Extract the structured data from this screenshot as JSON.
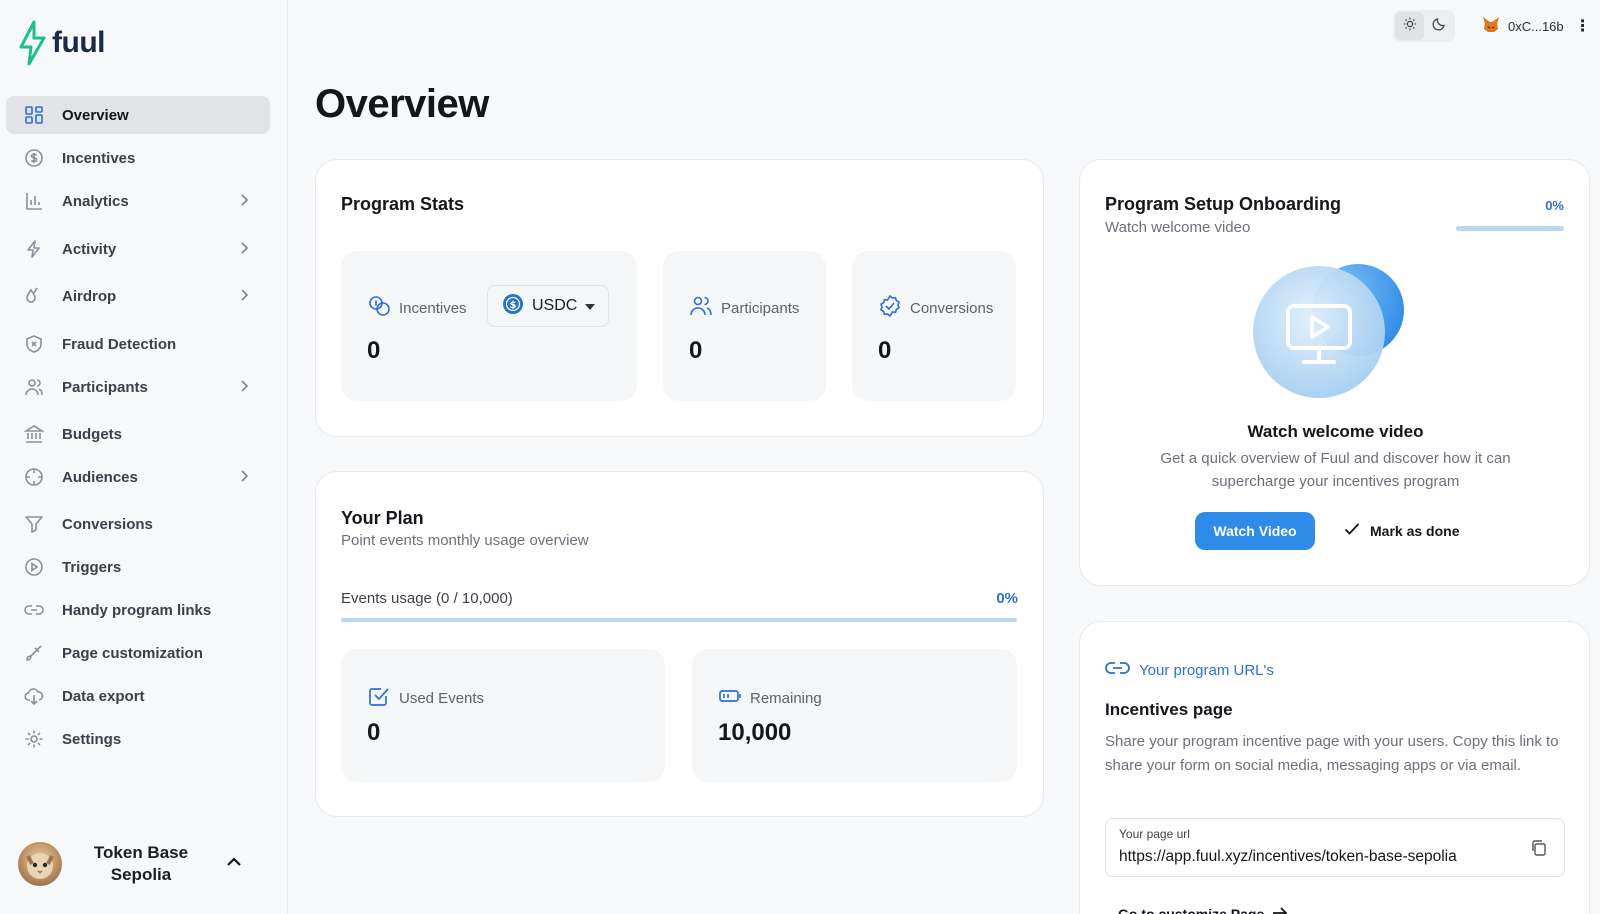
{
  "brand": {
    "name": "fuul"
  },
  "sidebar": {
    "items": [
      {
        "label": "Overview"
      },
      {
        "label": "Incentives"
      },
      {
        "label": "Analytics"
      },
      {
        "label": "Activity"
      },
      {
        "label": "Airdrop"
      },
      {
        "label": "Fraud Detection"
      },
      {
        "label": "Participants"
      },
      {
        "label": "Budgets"
      },
      {
        "label": "Audiences"
      },
      {
        "label": "Conversions"
      },
      {
        "label": "Triggers"
      },
      {
        "label": "Handy program links"
      },
      {
        "label": "Page customization"
      },
      {
        "label": "Data export"
      },
      {
        "label": "Settings"
      }
    ],
    "account": {
      "name": "Token Base Sepolia"
    }
  },
  "topbar": {
    "wallet": "0xC...16b"
  },
  "page": {
    "title": "Overview"
  },
  "program_stats": {
    "title": "Program Stats",
    "incentives": {
      "label": "Incentives",
      "currency": "USDC",
      "value": "0"
    },
    "participants": {
      "label": "Participants",
      "value": "0"
    },
    "conversions": {
      "label": "Conversions",
      "value": "0"
    }
  },
  "plan": {
    "title": "Your Plan",
    "subtitle": "Point events monthly usage overview",
    "usage_label": "Events usage (0 / 10,000)",
    "usage_percent": "0%",
    "usage_fraction": 0,
    "used": {
      "label": "Used Events",
      "value": "0"
    },
    "remaining": {
      "label": "Remaining",
      "value": "10,000"
    }
  },
  "onboarding": {
    "title": "Program Setup Onboarding",
    "subtitle": "Watch welcome video",
    "percent": "0%",
    "progress_fraction": 0,
    "heading": "Watch welcome video",
    "description": "Get a quick overview of Fuul and discover how it can supercharge your incentives program",
    "watch_button": "Watch Video",
    "done_button": "Mark as done"
  },
  "urls": {
    "link_label": "Your program URL's",
    "title": "Incentives page",
    "description": "Share your program incentive page with your users. Copy this link to share your form on social media, messaging apps or via email.",
    "field_label": "Your page url",
    "field_value": "https://app.fuul.xyz/incentives/token-base-sepolia",
    "customize_link": "Go to customize Page"
  },
  "colors": {
    "accent": "#2e8be8",
    "icon_blue": "#2e6fd6"
  }
}
